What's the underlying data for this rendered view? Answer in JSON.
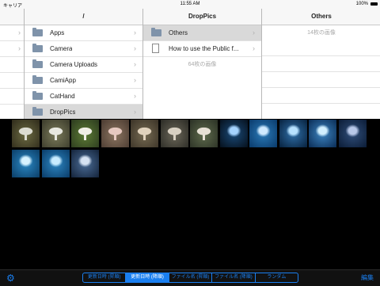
{
  "status": {
    "carrier": "キャリア",
    "time": "11:55 AM",
    "battery": "100%"
  },
  "column_root": {
    "header": "/",
    "rows": [
      {
        "label": "Apps"
      },
      {
        "label": "Camera"
      },
      {
        "label": "Camera Uploads"
      },
      {
        "label": "CamiApp"
      },
      {
        "label": "CatHand"
      },
      {
        "label": "DropPics"
      }
    ]
  },
  "column_droppics": {
    "header": "DropPics",
    "rows": [
      {
        "label": "Others"
      },
      {
        "label": "How to use the Public f..."
      }
    ],
    "count_label": "64枚の画像"
  },
  "column_others": {
    "header": "Others",
    "count_label": "14枚の画像"
  },
  "thumbnails": [
    {
      "subject": "mushroom",
      "palette": [
        "#2e2a1a",
        "#6b6a42",
        "#dcdcd2"
      ]
    },
    {
      "subject": "mushroom",
      "palette": [
        "#3a3a2a",
        "#7a7a5a",
        "#e8e8e0"
      ]
    },
    {
      "subject": "mushroom",
      "palette": [
        "#2b3a1e",
        "#5c7a35",
        "#f0eee6"
      ]
    },
    {
      "subject": "mushroom",
      "palette": [
        "#4a3a30",
        "#8a7460",
        "#e6c8c0"
      ]
    },
    {
      "subject": "mushroom",
      "palette": [
        "#3a3226",
        "#756a52",
        "#e0d2bc"
      ]
    },
    {
      "subject": "mushroom",
      "palette": [
        "#2a2a24",
        "#6a6658",
        "#d8d0c2"
      ]
    },
    {
      "subject": "mushroom",
      "palette": [
        "#2a3024",
        "#5e6a4c",
        "#e6e0d4"
      ]
    },
    {
      "subject": "jellyfish",
      "palette": [
        "#06101c",
        "#1a4a78",
        "#a6d4ff"
      ]
    },
    {
      "subject": "jellyfish",
      "palette": [
        "#0a3a6a",
        "#2a7ab8",
        "#cfeaff"
      ]
    },
    {
      "subject": "jellyfish",
      "palette": [
        "#07213d",
        "#2f6fa8",
        "#b7e2ff"
      ]
    },
    {
      "subject": "jellyfish",
      "palette": [
        "#0a2c55",
        "#3c84c0",
        "#d2f0ff"
      ]
    },
    {
      "subject": "jellyfish",
      "palette": [
        "#0b1c36",
        "#304e7a",
        "#b8c8e8"
      ]
    },
    {
      "subject": "jellyfish",
      "palette": [
        "#0b3d66",
        "#2a88c4",
        "#d6f2ff"
      ]
    },
    {
      "subject": "jellyfish",
      "palette": [
        "#0a3c68",
        "#2d86c2",
        "#c8ecff"
      ]
    },
    {
      "subject": "jellyfish",
      "palette": [
        "#14233a",
        "#4a6c96",
        "#d6e2f2"
      ]
    }
  ],
  "sort_segments": [
    "更新日時 (昇順)",
    "更新日時 (降順)",
    "ファイル名 (昇順)",
    "ファイル名 (降順)",
    "ランダム"
  ],
  "active_sort_index": 1,
  "edit_label": "編集",
  "colors": {
    "accent": "#1a7ff0",
    "selected_row": "#d9d9d9",
    "folder": "#7f93aa"
  }
}
